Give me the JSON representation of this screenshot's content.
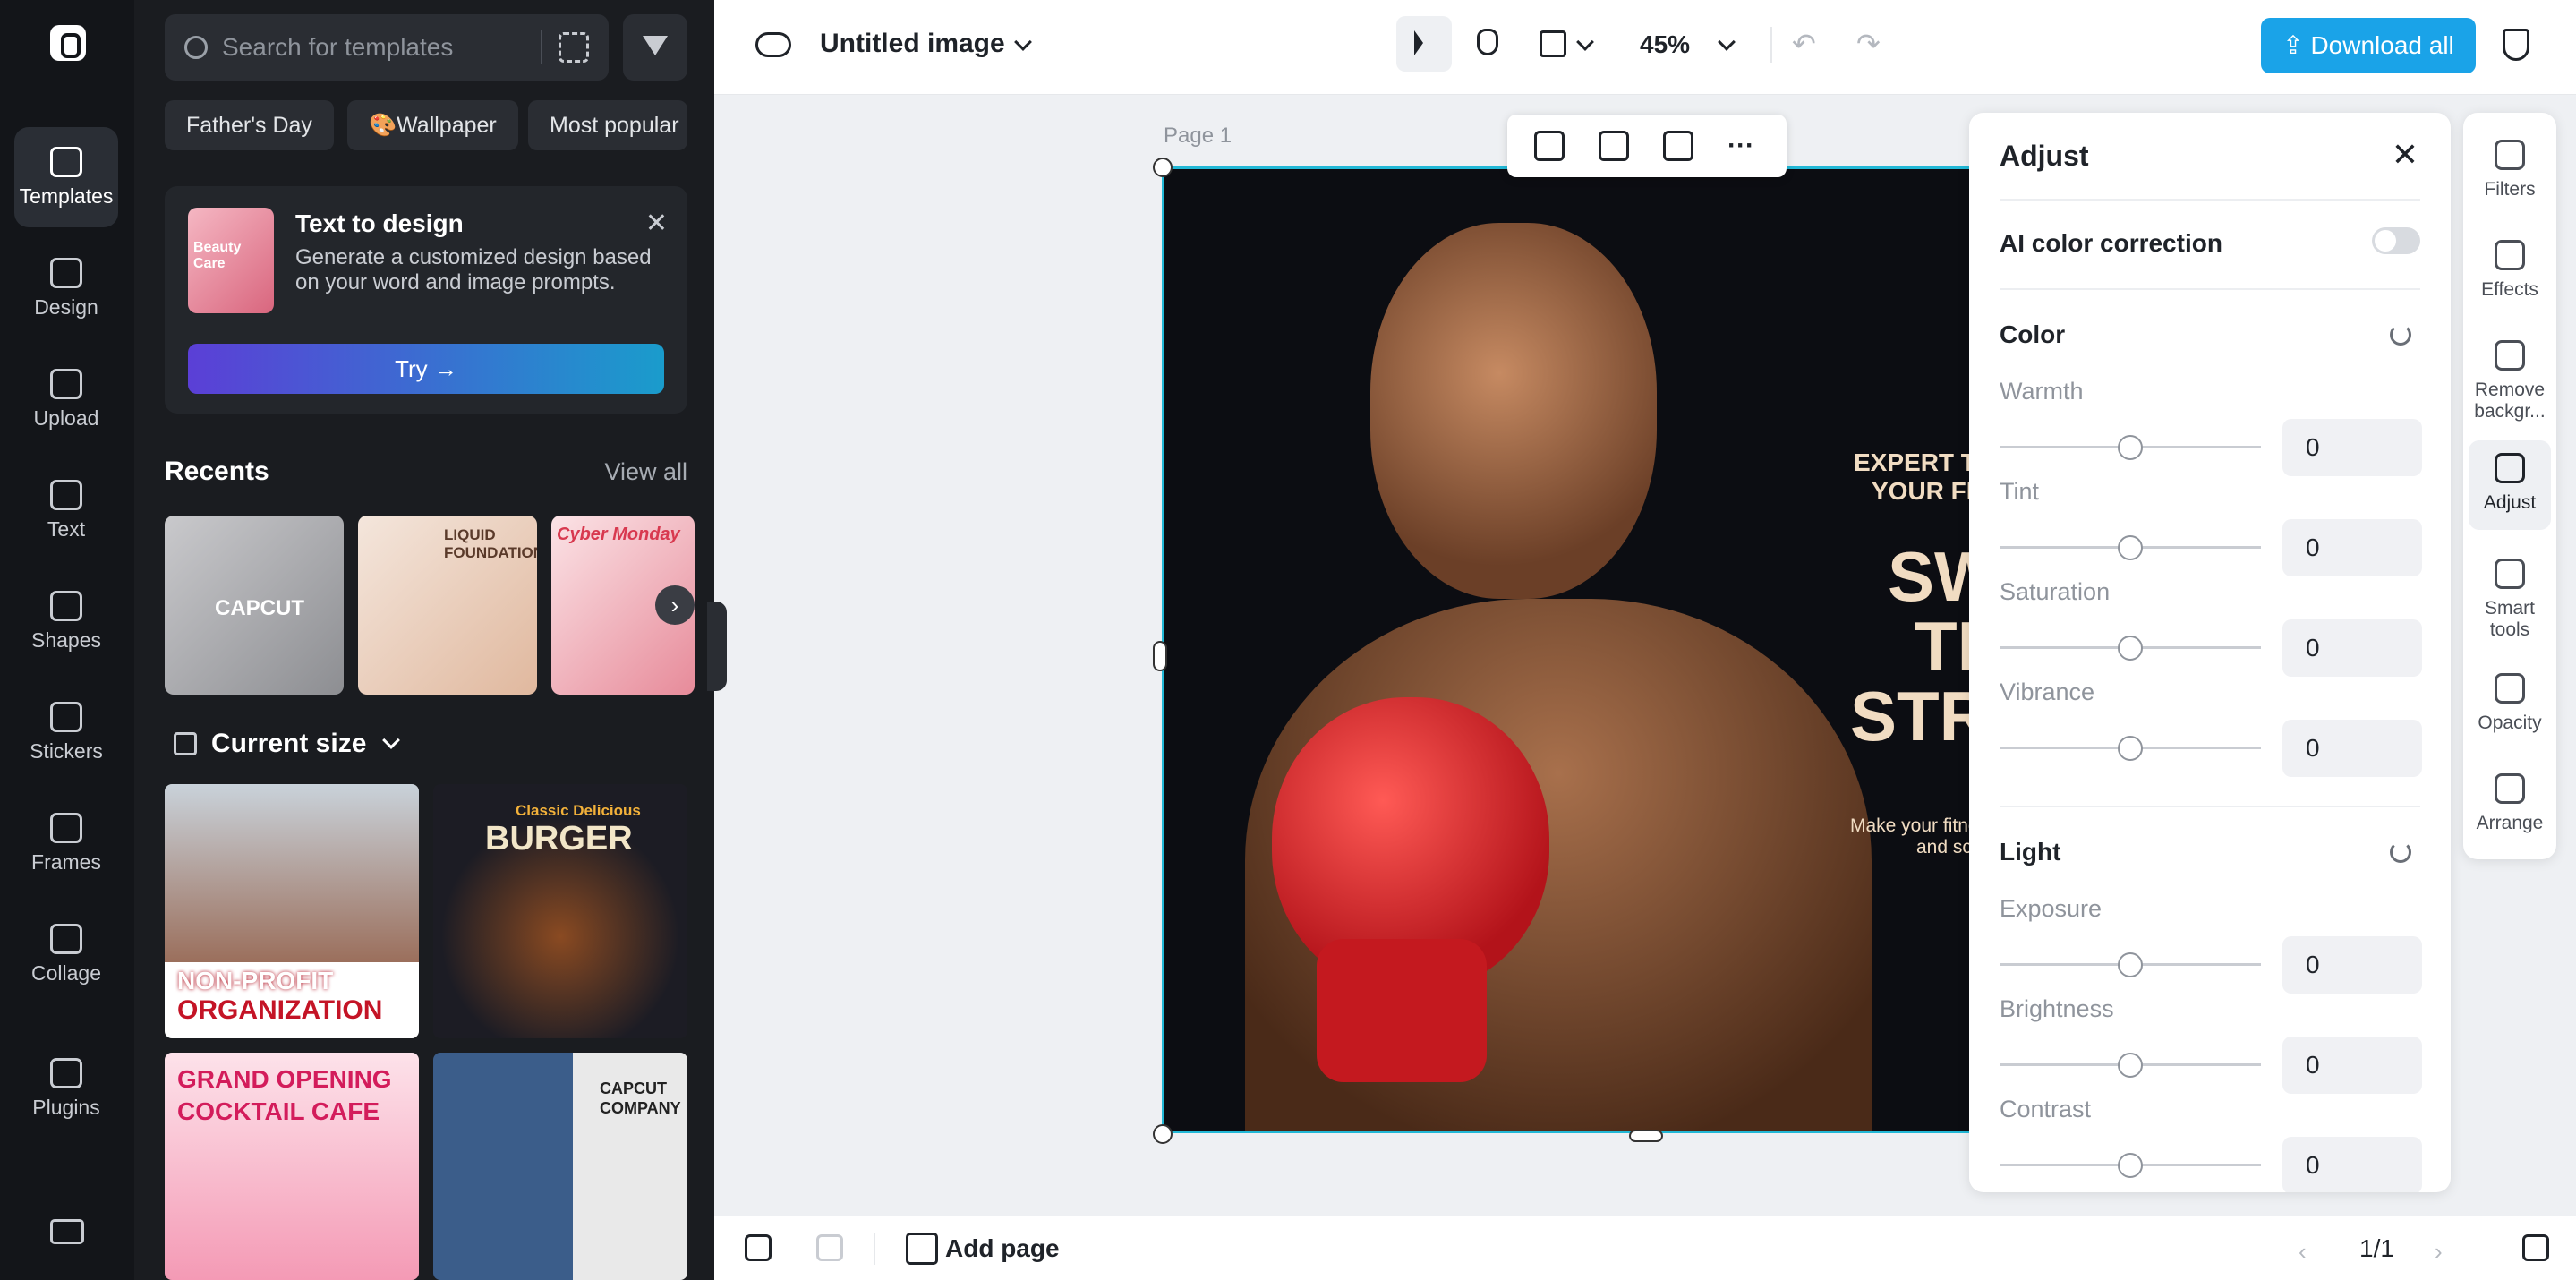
{
  "rail": {
    "items": [
      {
        "label": "Templates",
        "icon": "templates-icon"
      },
      {
        "label": "Design",
        "icon": "design-icon"
      },
      {
        "label": "Upload",
        "icon": "upload-icon"
      },
      {
        "label": "Text",
        "icon": "text-icon"
      },
      {
        "label": "Shapes",
        "icon": "shapes-icon"
      },
      {
        "label": "Stickers",
        "icon": "stickers-icon"
      },
      {
        "label": "Frames",
        "icon": "frames-icon"
      },
      {
        "label": "Collage",
        "icon": "collage-icon"
      },
      {
        "label": "Plugins",
        "icon": "plugins-icon"
      }
    ]
  },
  "panel": {
    "search_placeholder": "Search for templates",
    "chips": [
      "Father's Day",
      "🎨Wallpaper",
      "Most popular"
    ],
    "text_to_design": {
      "thumb_text": "Beauty Care",
      "title": "Text to design",
      "desc": "Generate a customized design based on your word and image prompts.",
      "try_label": "Try →"
    },
    "recents_title": "Recents",
    "view_all": "View all",
    "recents": [
      {
        "text": "CAPCUT"
      },
      {
        "text": "LIQUID FOUNDATION"
      },
      {
        "text": "Cyber Monday"
      }
    ],
    "size_title": "Current size",
    "templates": [
      {
        "line1": "NON-PROFIT",
        "line2": "ORGANIZATION"
      },
      {
        "line1": "Classic Delicious",
        "line2": "BURGER"
      },
      {
        "line1": "GRAND OPENING",
        "line2": "COCKTAIL CAFE"
      },
      {
        "line1": "CAPCUT",
        "line2": "COMPANY"
      }
    ]
  },
  "topbar": {
    "title": "Untitled image",
    "zoom": "45%",
    "download_label": "Download all"
  },
  "canvas": {
    "page_label": "Page 1",
    "poster": {
      "line1": "EXPERT TRAIN",
      "line2": "YOUR FITNE",
      "big1": "SWE",
      "big2": "TH",
      "big3": "STRO",
      "small1": "Make your fitnes",
      "small2": "and sc"
    }
  },
  "adjust": {
    "title": "Adjust",
    "ai_label": "AI color correction",
    "color_title": "Color",
    "light_title": "Light",
    "color_sliders": [
      {
        "label": "Warmth",
        "value": "0"
      },
      {
        "label": "Tint",
        "value": "0"
      },
      {
        "label": "Saturation",
        "value": "0"
      },
      {
        "label": "Vibrance",
        "value": "0"
      }
    ],
    "light_sliders": [
      {
        "label": "Exposure",
        "value": "0"
      },
      {
        "label": "Brightness",
        "value": "0"
      },
      {
        "label": "Contrast",
        "value": "0"
      }
    ]
  },
  "tools": [
    {
      "label": "Filters",
      "icon": "filters-icon"
    },
    {
      "label": "Effects",
      "icon": "effects-icon"
    },
    {
      "label": "Remove backgr...",
      "icon": "remove-background-icon"
    },
    {
      "label": "Adjust",
      "icon": "adjust-icon"
    },
    {
      "label": "Smart tools",
      "icon": "smart-tools-icon"
    },
    {
      "label": "Opacity",
      "icon": "opacity-icon"
    },
    {
      "label": "Arrange",
      "icon": "arrange-icon"
    }
  ],
  "bottom": {
    "add_page": "Add page",
    "pager": "1/1"
  }
}
